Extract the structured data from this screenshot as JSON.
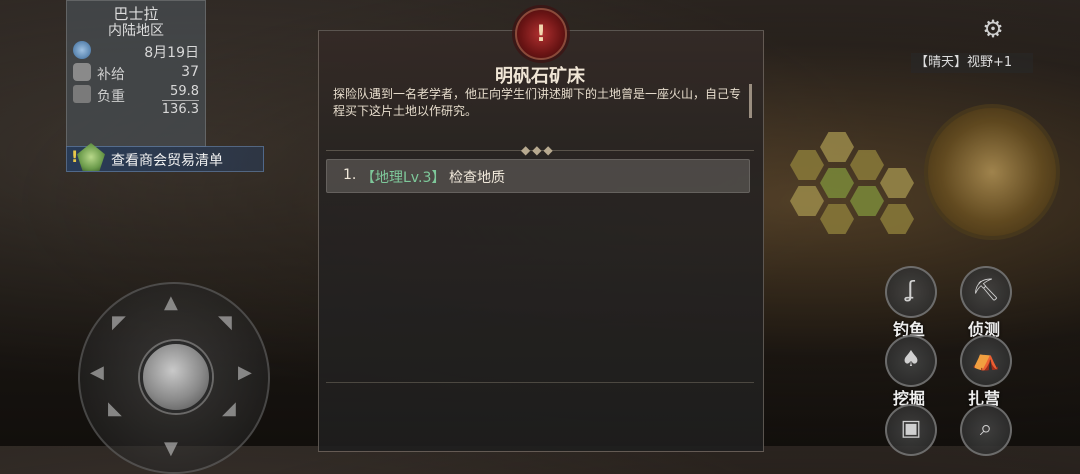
{
  "location": {
    "name": "巴士拉",
    "region": "内陆地区",
    "date": "8月19日"
  },
  "stats": {
    "supply_label": "补给",
    "supply_value": "37",
    "load_label": "负重",
    "load_current": "59.8",
    "load_max": "136.3"
  },
  "trade_list": {
    "label": "查看商会贸易清单"
  },
  "dialog": {
    "badge": "!",
    "title": "明矾石矿床",
    "description": "探险队遇到一名老学者，他正向学生们讲述脚下的土地曾是一座火山，自己专程买下这片土地以作研究。",
    "options": [
      {
        "number": "1.",
        "tag": "【地理Lv.3】",
        "action": "检查地质"
      }
    ]
  },
  "weather": {
    "text": "【晴天】视野+1"
  },
  "actions": {
    "fishing": "钓鱼",
    "scout": "侦测",
    "dig": "挖掘",
    "camp": "扎营"
  },
  "icons": {
    "settings": "gear-icon",
    "fishing": "fishing-hook-icon",
    "scout": "pickaxe-icon",
    "dig": "shovel-icon",
    "camp": "tent-icon",
    "inventory": "backpack-icon",
    "search": "magnifier-icon"
  }
}
